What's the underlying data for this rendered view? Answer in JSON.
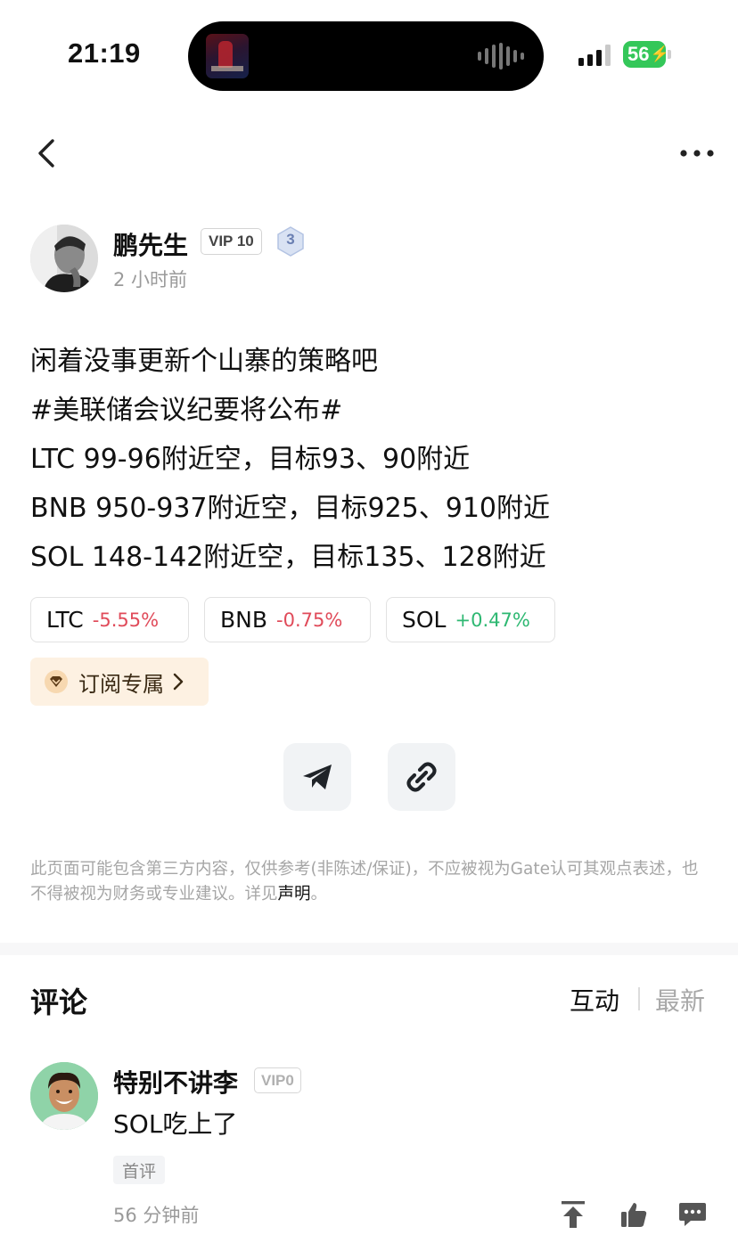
{
  "status_bar": {
    "time": "21:19",
    "battery": "56"
  },
  "nav": {
    "back_icon": "chevron-left-icon",
    "more_icon": "more-horizontal-icon"
  },
  "post": {
    "author": {
      "name": "鹏先生",
      "vip": "VIP 10",
      "level": "3"
    },
    "time": "2 小时前",
    "lines": [
      "闲着没事更新个山寨的策略吧",
      "#美联储会议纪要将公布#",
      "LTC 99-96附近空，目标93、90附近",
      "BNB 950-937附近空，目标925、910附近",
      "SOL 148-142附近空，目标135、128附近"
    ],
    "tags": [
      {
        "symbol": "LTC",
        "change": "-5.55%",
        "direction": "down"
      },
      {
        "symbol": "BNB",
        "change": "-0.75%",
        "direction": "down"
      },
      {
        "symbol": "SOL",
        "change": "+0.47%",
        "direction": "up"
      }
    ],
    "subscribe_label": "订阅专属",
    "disclaimer": "此页面可能包含第三方内容，仅供参考(非陈述/保证)，不应被视为Gate认可其观点表述，也不得被视为财务或专业建议。详见",
    "disclaimer_link": "声明",
    "disclaimer_end": "。"
  },
  "comments": {
    "title": "评论",
    "sort_hot": "互动",
    "sort_new": "最新",
    "items": [
      {
        "name": "特别不讲李",
        "vip": "VIP0",
        "text": "SOL吃上了",
        "badge": "首评",
        "time": "56 分钟前"
      }
    ]
  },
  "colors": {
    "negative": "#e04b5a",
    "positive": "#2eb872",
    "battery": "#34c759",
    "subscribe_bg": "#fdf1e2"
  }
}
